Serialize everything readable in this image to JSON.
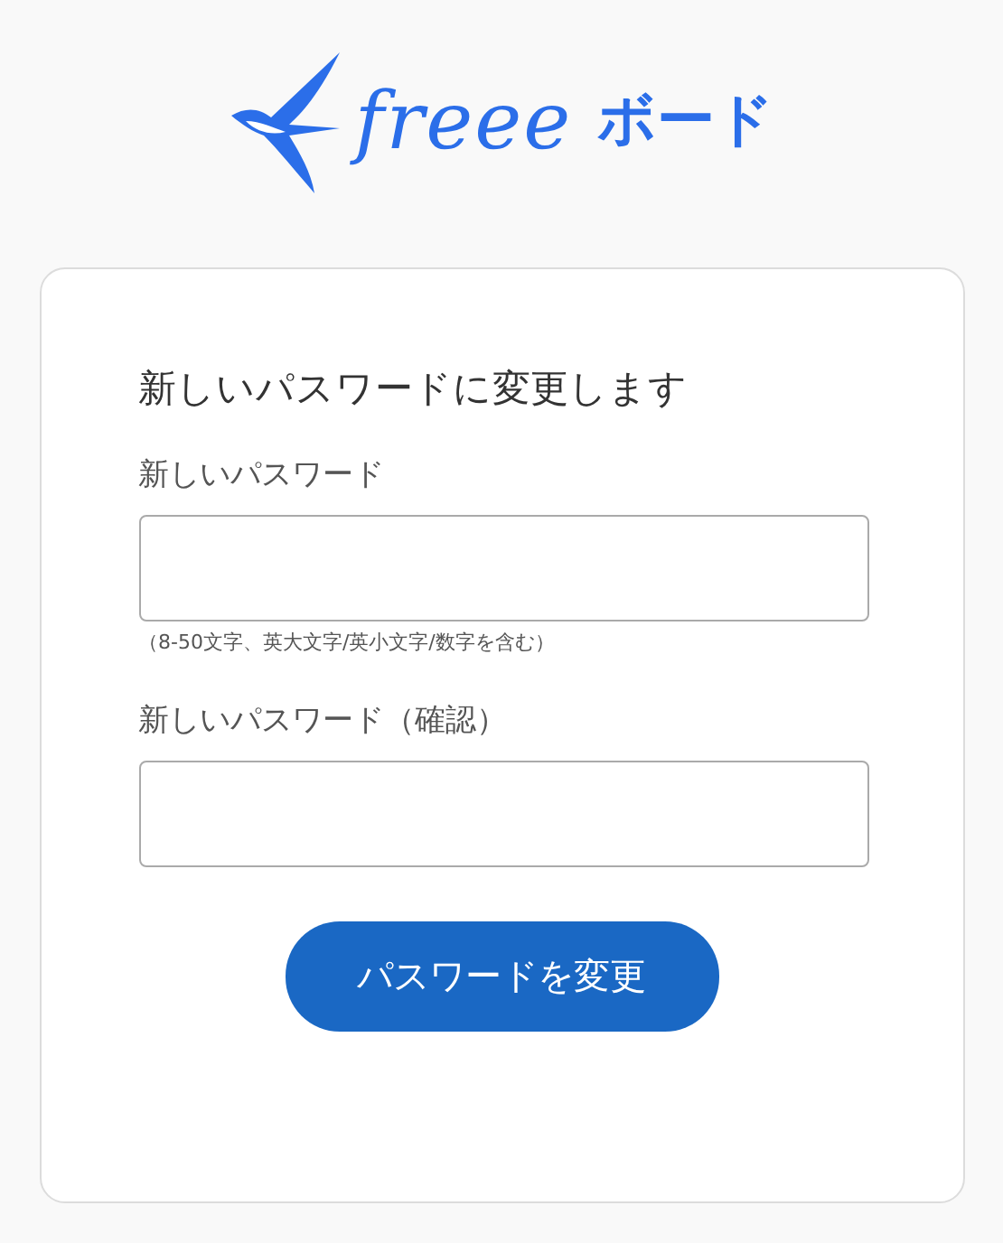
{
  "logo": {
    "brand": "freee",
    "product": "ボード"
  },
  "form": {
    "title": "新しいパスワードに変更します",
    "fields": [
      {
        "label": "新しいパスワード",
        "hint": "（8-50文字、英大文字/英小文字/数字を含む）"
      },
      {
        "label": "新しいパスワード（確認）"
      }
    ],
    "submit": "パスワードを変更"
  }
}
